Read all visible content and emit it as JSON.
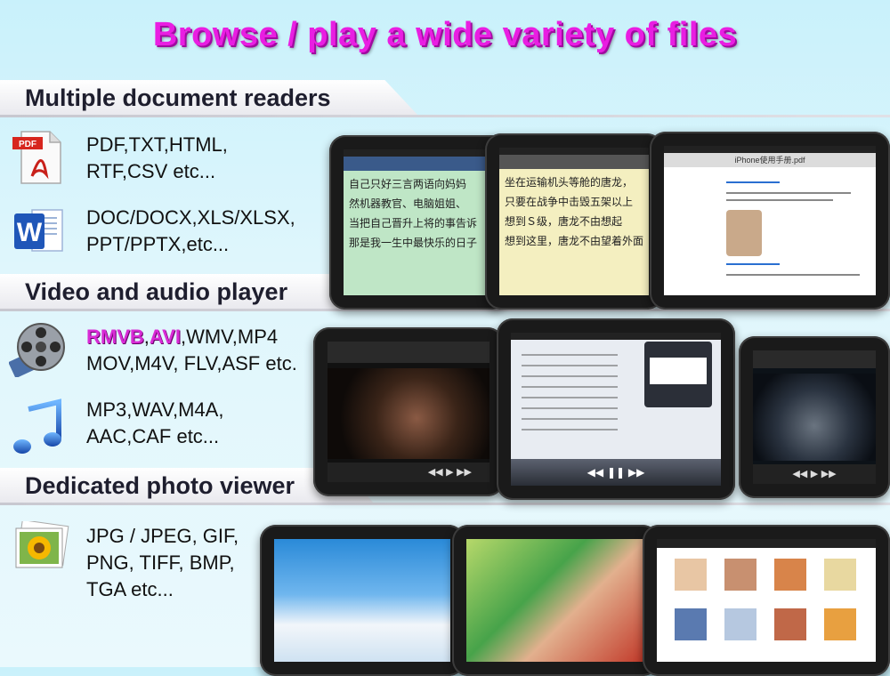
{
  "title": "Browse / play a wide variety of files",
  "sections": [
    {
      "heading": "Multiple document readers"
    },
    {
      "heading": "Video and audio player"
    },
    {
      "heading": "Dedicated photo viewer"
    }
  ],
  "documents": {
    "pdf_line1": "PDF,TXT,HTML,",
    "pdf_line2": "RTF,CSV etc...",
    "office_line1": "DOC/DOCX,XLS/XLSX,",
    "office_line2": "PPT/PPTX,etc..."
  },
  "media": {
    "video_hl1": "RMVB",
    "video_sep": ",",
    "video_hl2": "AVI",
    "video_rest": ",WMV,MP4",
    "video_line2": "MOV,M4V, FLV,ASF etc.",
    "audio_line1": "MP3,WAV,M4A,",
    "audio_line2": "AAC,CAF etc..."
  },
  "photos": {
    "line1": "JPG / JPEG, GIF,",
    "line2": "PNG, TIFF, BMP,",
    "line3": "TGA etc..."
  },
  "icons": {
    "pdf_badge": "PDF",
    "word_letter": "W"
  },
  "screens": {
    "reader_a_lines": [
      "自己只好三言两语向妈妈",
      "然机器教官、电脑姐姐、",
      "当把自己晋升上将的事告诉",
      "那是我一生中最快乐的日子"
    ],
    "reader_b_lines": [
      "坐在运输机头等舱的唐龙，",
      "只要在战争中击毁五架以上",
      "想到Ｓ级，唐龙不由想起",
      "想到这里，唐龙不由望着外面"
    ],
    "pdf_header": "iPhone使用手册.pdf"
  },
  "colors": {
    "title": "#e91ee2",
    "highlight": "#d82bd6",
    "reader_green": "#bfe6c6",
    "reader_yellow": "#f4efc0"
  }
}
